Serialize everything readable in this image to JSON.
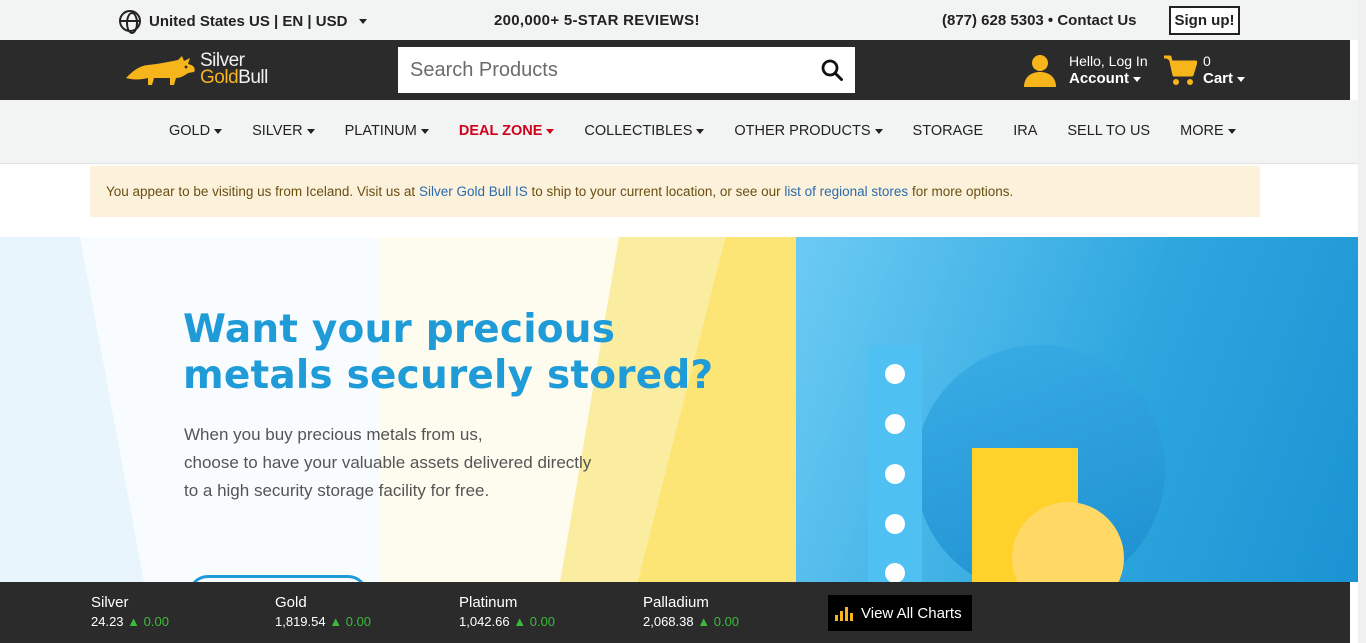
{
  "topbar": {
    "locale": "United States US | EN | USD",
    "reviews": "200,000+ 5-STAR REVIEWS!",
    "phone_contact": "(877) 628 5303 • Contact Us",
    "signup": "Sign up!"
  },
  "header": {
    "logo_line1": "Silver",
    "logo_line2": "Gold",
    "logo_line2b": "Bull",
    "search_placeholder": "Search Products",
    "account_hello": "Hello, Log In",
    "account_label": "Account",
    "cart_count": "0",
    "cart_label": "Cart"
  },
  "nav": {
    "items": [
      {
        "label": "GOLD",
        "dropdown": true
      },
      {
        "label": "SILVER",
        "dropdown": true
      },
      {
        "label": "PLATINUM",
        "dropdown": true
      },
      {
        "label": "DEAL ZONE",
        "dropdown": true
      },
      {
        "label": "COLLECTIBLES",
        "dropdown": true
      },
      {
        "label": "OTHER PRODUCTS",
        "dropdown": true
      },
      {
        "label": "STORAGE",
        "dropdown": false
      },
      {
        "label": "IRA",
        "dropdown": false
      },
      {
        "label": "SELL TO US",
        "dropdown": false
      },
      {
        "label": "MORE",
        "dropdown": true
      }
    ]
  },
  "alert": {
    "text1": "You appear to be visiting us from Iceland. Visit us at ",
    "link1": "Silver Gold Bull IS",
    "text2": " to ship to your current location, or see our ",
    "link2": "list of regional stores",
    "text3": " for more options."
  },
  "hero": {
    "headline_line1": "Want your precious",
    "headline_line2": "metals securely stored?",
    "body_line1": "When you buy precious metals from us,",
    "body_line2": "choose to have your valuable assets delivered directly",
    "body_line3": "to a high security storage facility for free."
  },
  "ticker": {
    "metals": [
      {
        "name": "Silver",
        "price": "24.23",
        "change": "0.00"
      },
      {
        "name": "Gold",
        "price": "1,819.54",
        "change": "0.00"
      },
      {
        "name": "Platinum",
        "price": "1,042.66",
        "change": "0.00"
      },
      {
        "name": "Palladium",
        "price": "2,068.38",
        "change": "0.00"
      }
    ],
    "charts_button": "View All Charts",
    "up_arrow": "▲"
  },
  "colors": {
    "dark_bar": "#2b2b2b",
    "brand_gold": "#f7b51c",
    "deal_red": "#d0021b",
    "hero_blue": "#1f9bd7",
    "ticker_up": "#3bba3b",
    "alert_bg": "#fcf2dc"
  }
}
